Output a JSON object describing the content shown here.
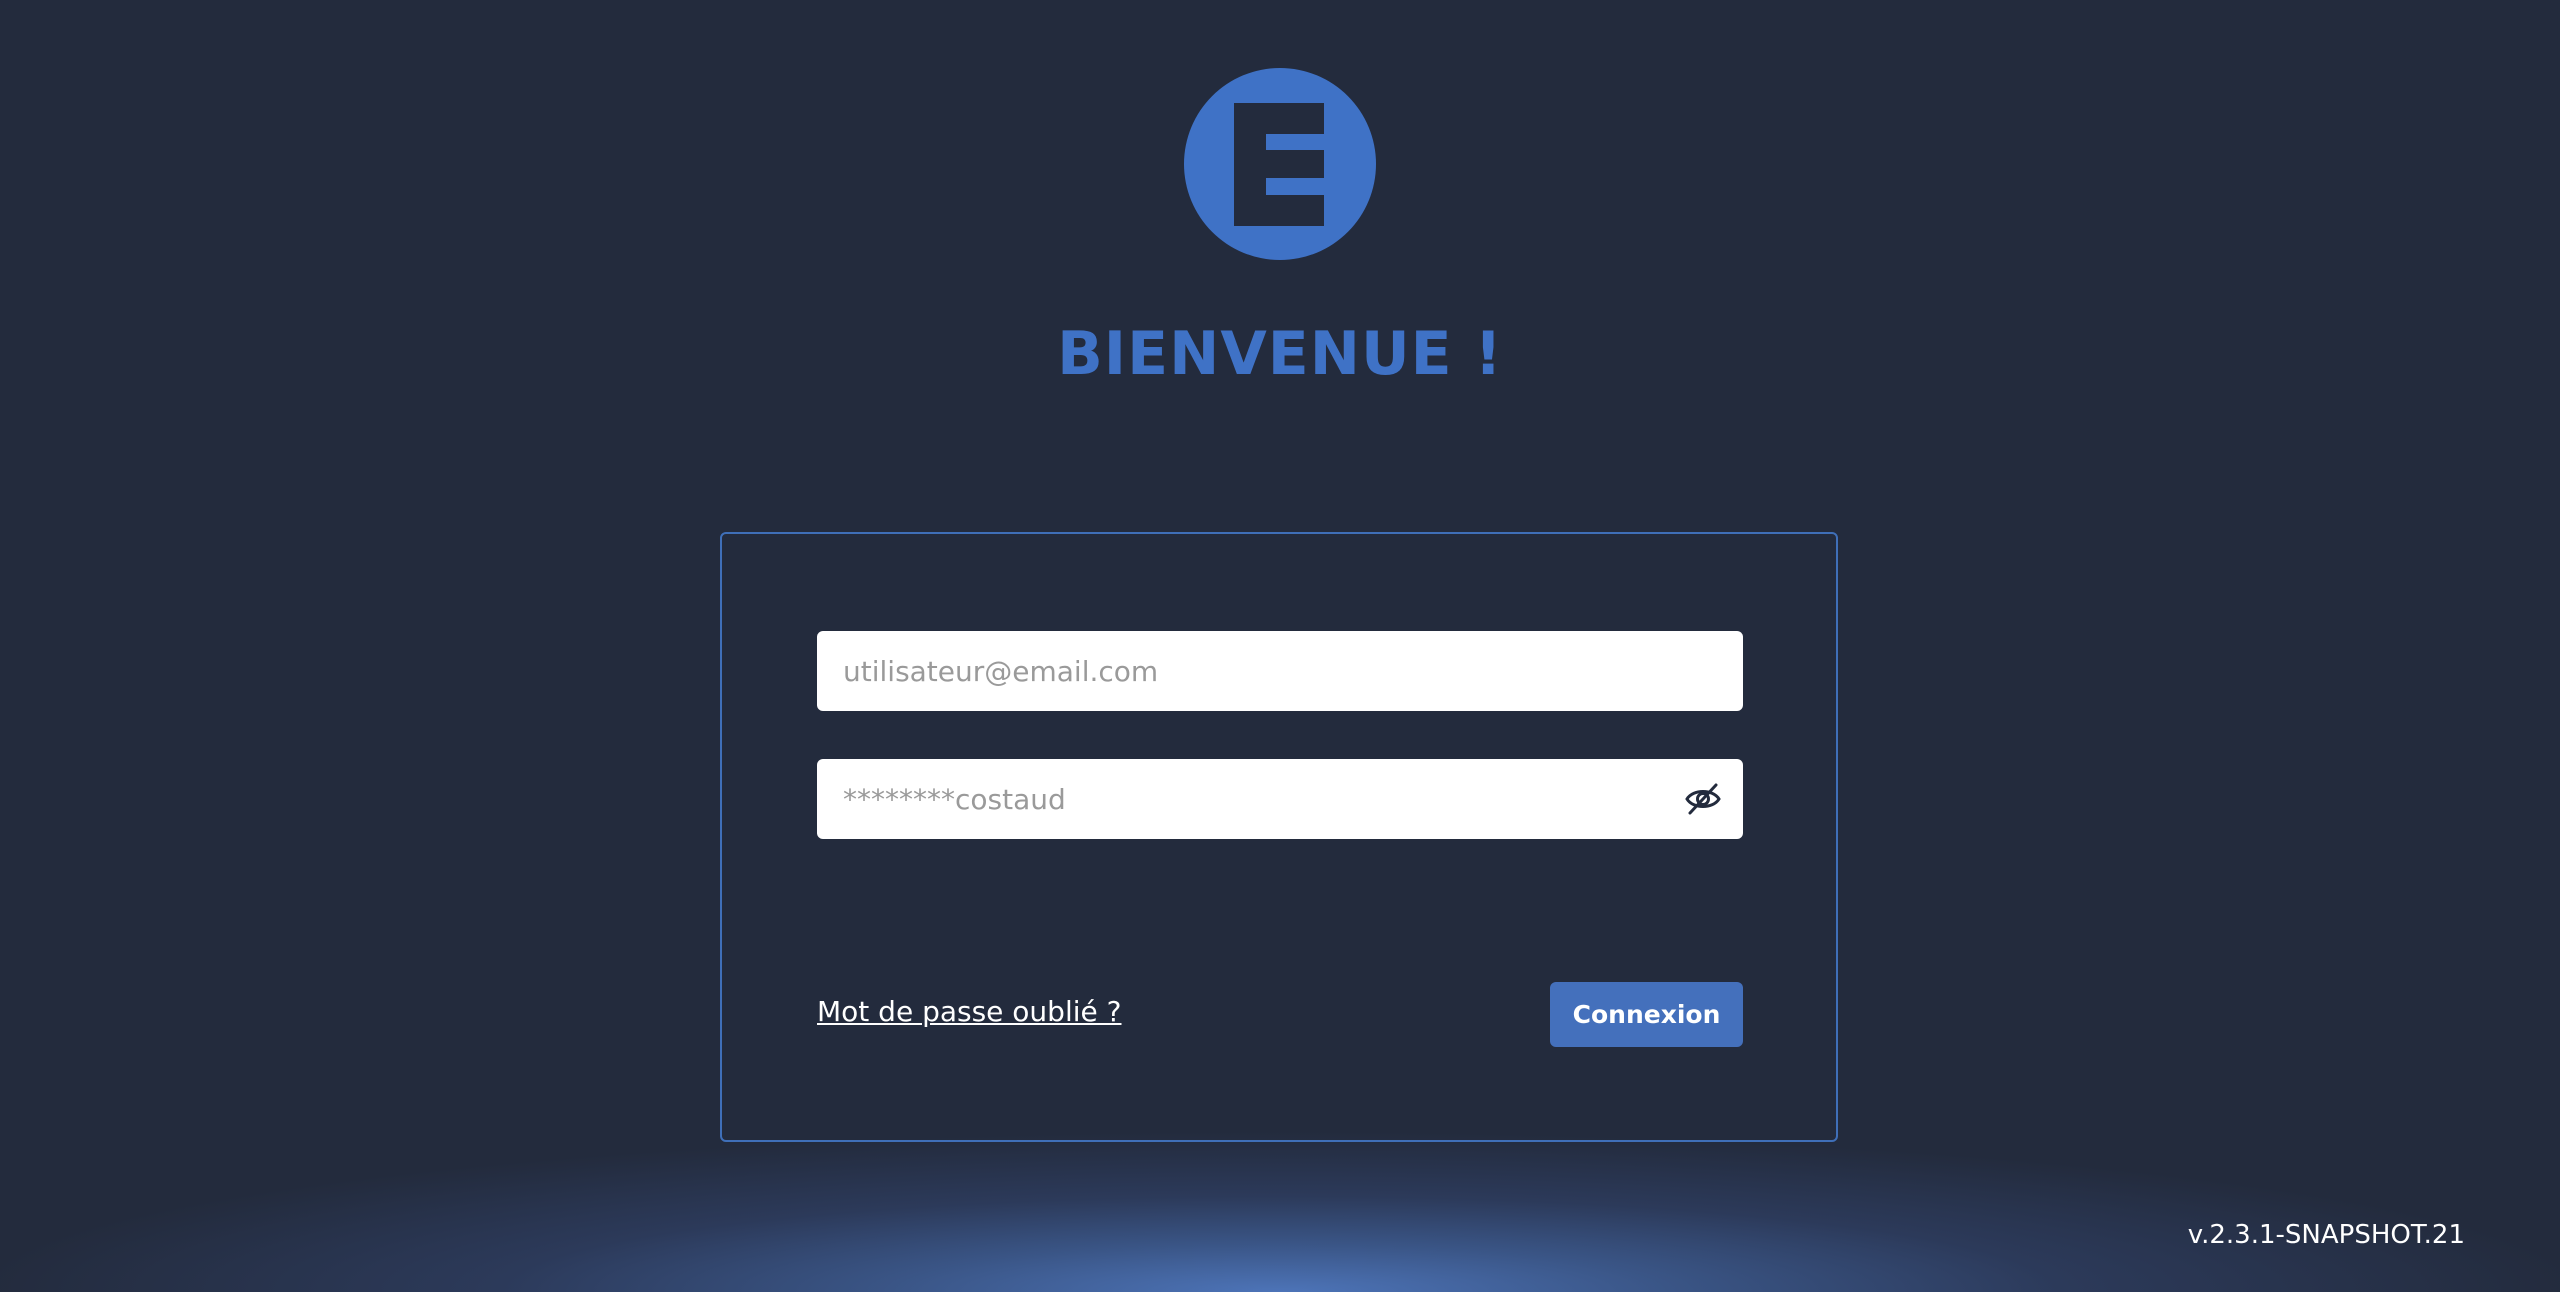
{
  "header": {
    "logo_icon": "logo-e-icon",
    "title": "BIENVENUE !"
  },
  "login_form": {
    "email_placeholder": "utilisateur@email.com",
    "password_placeholder": "********costaud",
    "toggle_visibility_icon": "eye-slash-icon",
    "forgot_password_label": "Mot de passe oublié ?",
    "submit_label": "Connexion"
  },
  "footer": {
    "version": "v.2.3.1-SNAPSHOT.21"
  },
  "colors": {
    "background": "#232b3d",
    "accent": "#3f72c6",
    "button": "#4470bc",
    "card_border": "#3f6fb8"
  }
}
